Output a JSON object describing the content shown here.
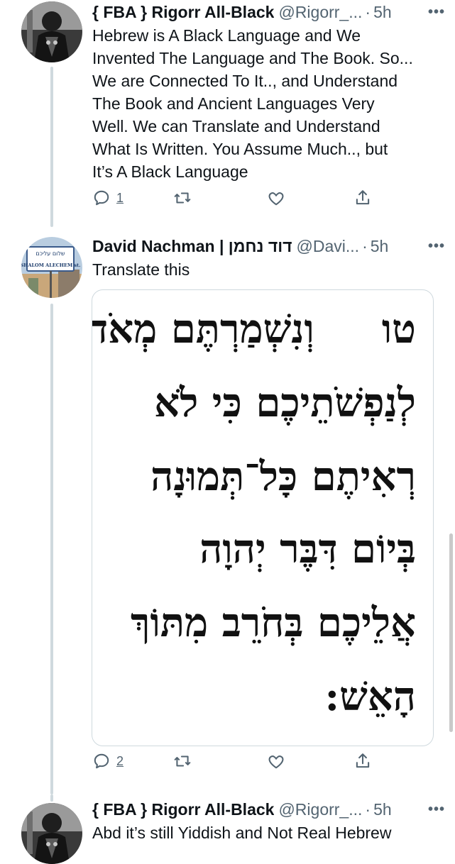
{
  "tweets": [
    {
      "name": "{ FBA } Rigorr All-Black",
      "handle": "@Rigorr_...",
      "separator": "·",
      "time": "5h",
      "more_label": "•••",
      "text_lines": [
        "Hebrew is A Black Language and We",
        "Invented The Language and The Book. So...",
        "We are Connected To It.., and Understand",
        "The Book and Ancient Languages Very",
        "Well. We can Translate and Understand",
        "What Is Written. You Assume Much.., but",
        "It’s A Black Language"
      ],
      "actions": {
        "reply_count": "1",
        "retweet_count": "",
        "like_count": ""
      }
    },
    {
      "name": "David Nachman | דוד נחמן",
      "handle": "@Davi...",
      "separator": "·",
      "time": "5h",
      "more_label": "•••",
      "text_lines": [
        "Translate this"
      ],
      "avatar_sign": {
        "line1": "שלום עליכם",
        "line2": "SHALOM ALECHEM st."
      },
      "media": {
        "verse_number": "טו",
        "hebrew_lines": [
          "וְנִשְׁמַרְתֶּם מְאֹד",
          "לְנַפְשֹׁתֵיכֶם כִּי לֹא",
          "רְאִיתֶם כָּל־תְּמוּנָה",
          "בְּיוֹם דִּבֶּר יְהוָה",
          "אֲלֵיכֶם בְּחֹרֵב מִתּוֹךְ",
          "הָאֵשׁ:"
        ]
      },
      "actions": {
        "reply_count": "2",
        "retweet_count": "",
        "like_count": ""
      }
    },
    {
      "name": "{ FBA } Rigorr All-Black",
      "handle": "@Rigorr_...",
      "separator": "·",
      "time": "5h",
      "more_label": "•••",
      "text_lines": [
        "Abd it’s still Yiddish and Not Real Hebrew"
      ]
    }
  ],
  "icons": {
    "reply": "reply-icon",
    "retweet": "retweet-icon",
    "like": "like-icon",
    "share": "share-icon",
    "more": "more-icon"
  },
  "colors": {
    "primary_text": "#0f1419",
    "secondary_text": "#536471",
    "thread_line": "#cfd9de",
    "border": "#cfd9de"
  }
}
